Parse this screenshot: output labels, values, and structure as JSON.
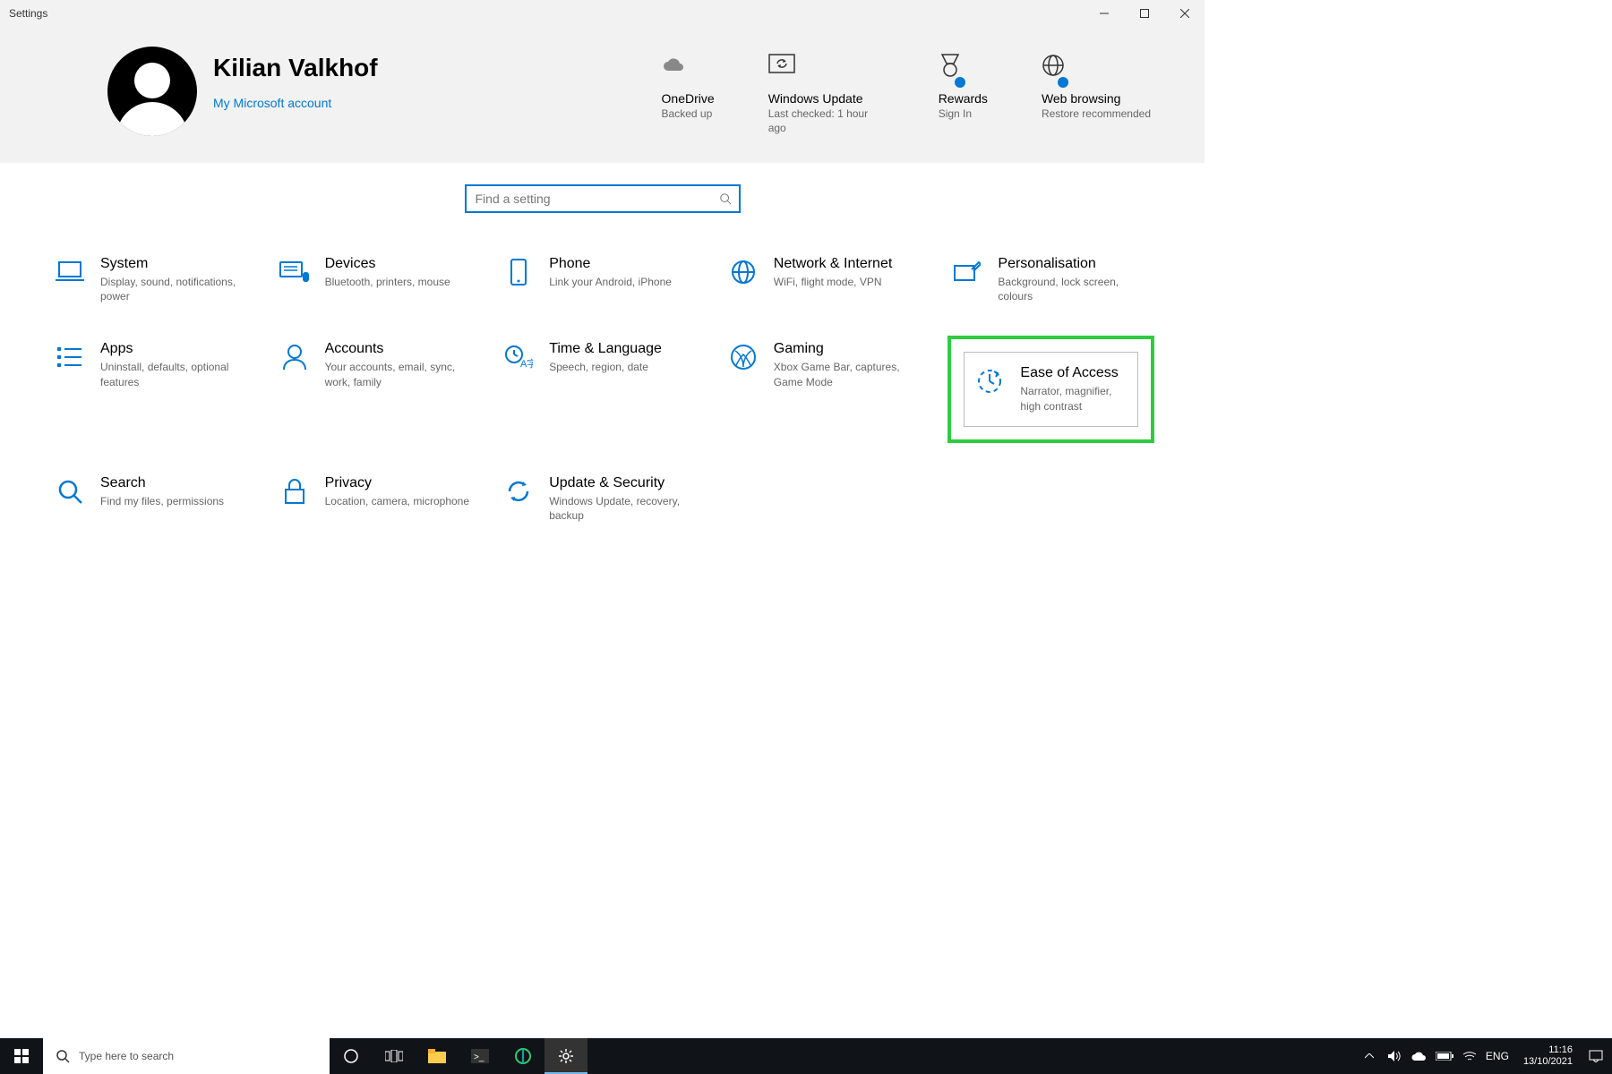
{
  "window": {
    "title": "Settings"
  },
  "user": {
    "name": "Kilian Valkhof",
    "account_link": "My Microsoft account"
  },
  "tiles": {
    "onedrive": {
      "label": "OneDrive",
      "sub": "Backed up"
    },
    "update": {
      "label": "Windows Update",
      "sub": "Last checked: 1 hour ago"
    },
    "rewards": {
      "label": "Rewards",
      "sub": "Sign In"
    },
    "browsing": {
      "label": "Web browsing",
      "sub": "Restore recommended"
    }
  },
  "search": {
    "placeholder": "Find a setting"
  },
  "categories": {
    "system": {
      "label": "System",
      "sub": "Display, sound, notifications, power"
    },
    "devices": {
      "label": "Devices",
      "sub": "Bluetooth, printers, mouse"
    },
    "phone": {
      "label": "Phone",
      "sub": "Link your Android, iPhone"
    },
    "network": {
      "label": "Network & Internet",
      "sub": "WiFi, flight mode, VPN"
    },
    "personal": {
      "label": "Personalisation",
      "sub": "Background, lock screen, colours"
    },
    "apps": {
      "label": "Apps",
      "sub": "Uninstall, defaults, optional features"
    },
    "accounts": {
      "label": "Accounts",
      "sub": "Your accounts, email, sync, work, family"
    },
    "time": {
      "label": "Time & Language",
      "sub": "Speech, region, date"
    },
    "gaming": {
      "label": "Gaming",
      "sub": "Xbox Game Bar, captures, Game Mode"
    },
    "ease": {
      "label": "Ease of Access",
      "sub": "Narrator, magnifier, high contrast"
    },
    "searchcat": {
      "label": "Search",
      "sub": "Find my files, permissions"
    },
    "privacy": {
      "label": "Privacy",
      "sub": "Location, camera, microphone"
    },
    "updatesec": {
      "label": "Update & Security",
      "sub": "Windows Update, recovery, backup"
    }
  },
  "taskbar": {
    "search_placeholder": "Type here to search",
    "lang": "ENG",
    "time": "11:16",
    "date": "13/10/2021"
  }
}
